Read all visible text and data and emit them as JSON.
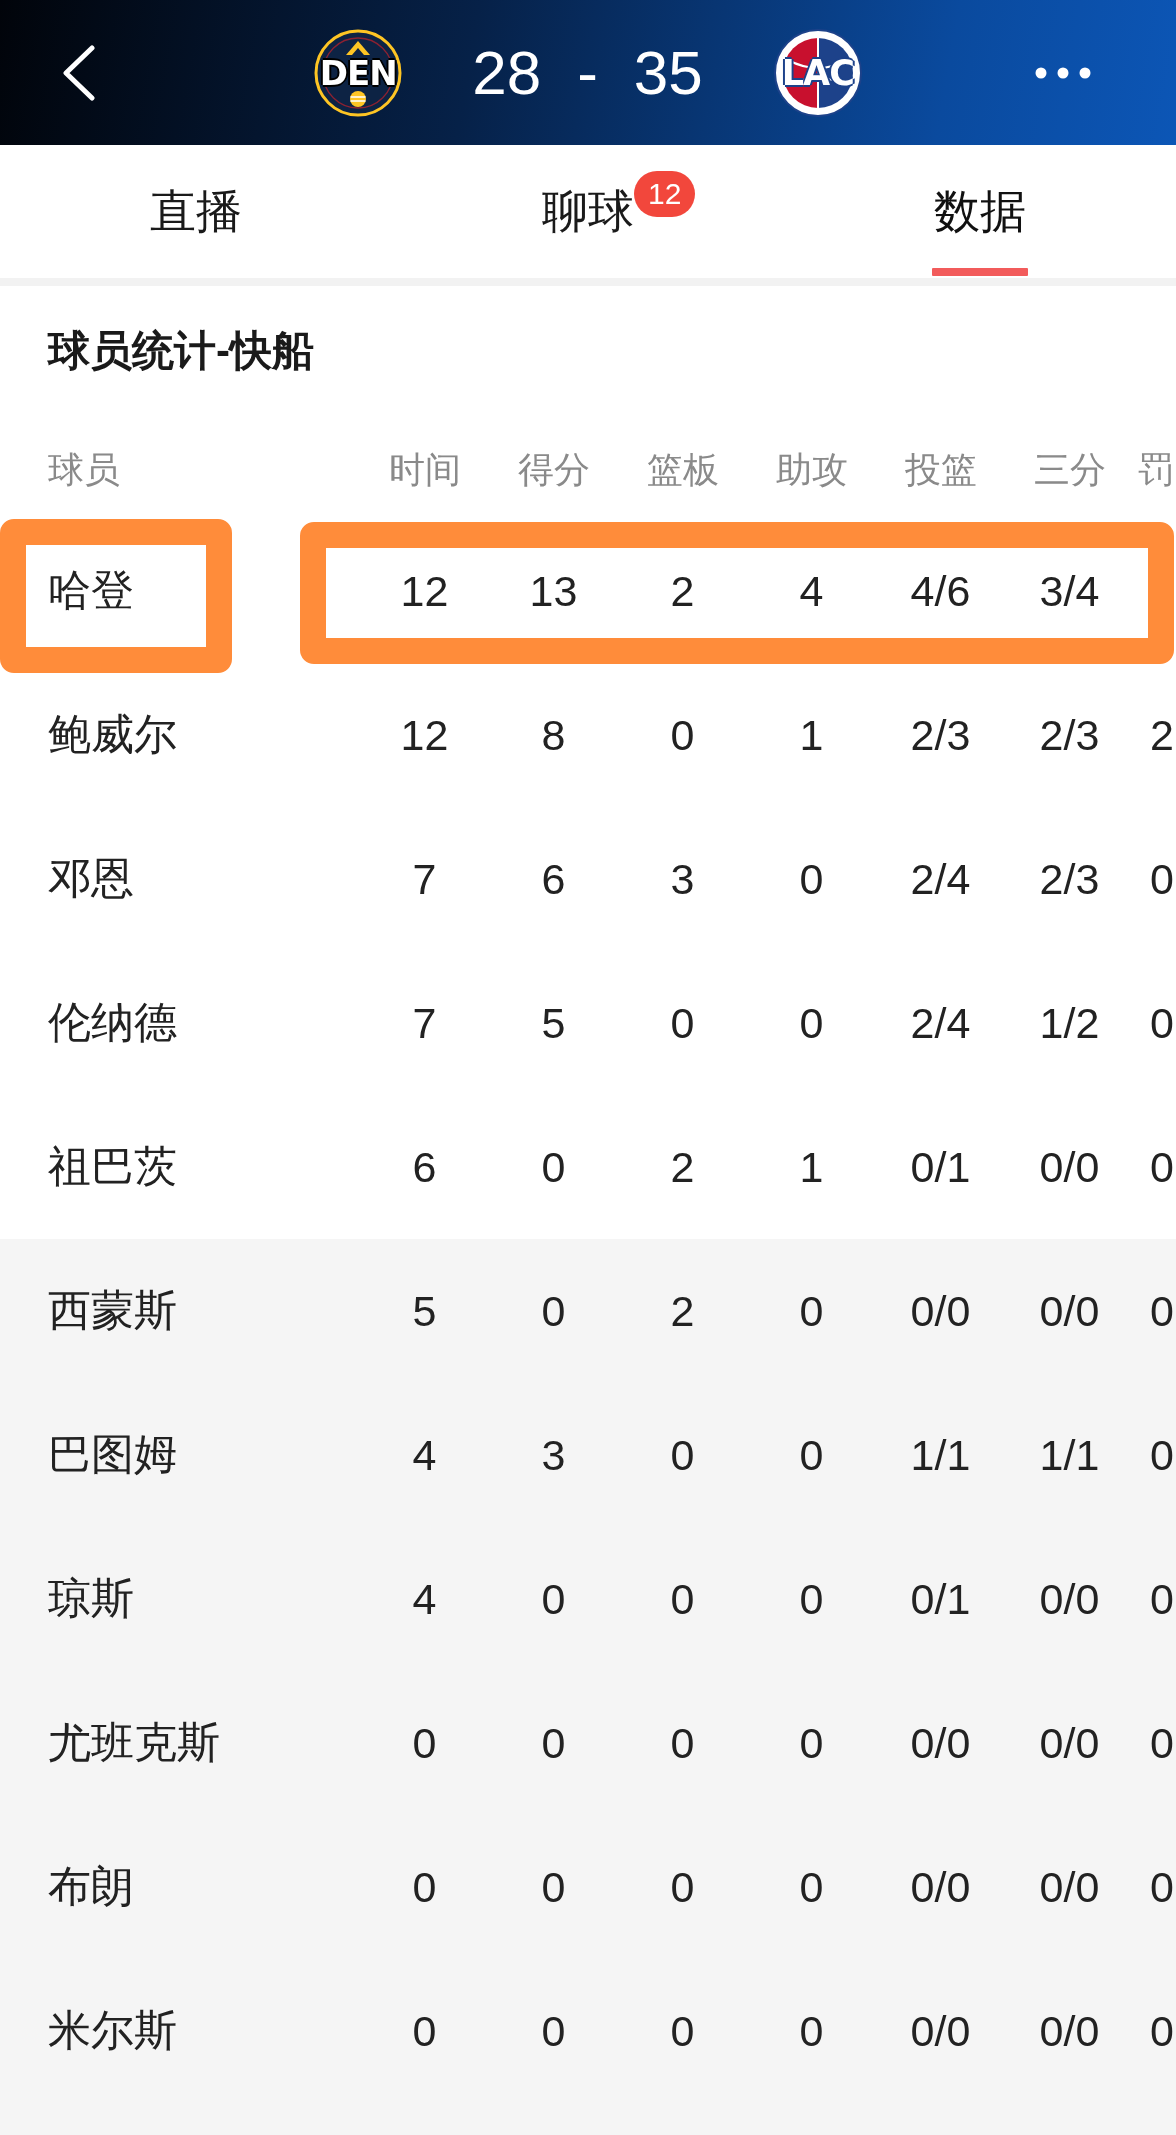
{
  "header": {
    "home": {
      "logo_text": "DEN",
      "score": "28"
    },
    "separator": "-",
    "away": {
      "logo_text": "LAC",
      "score": "35"
    }
  },
  "tabs": [
    {
      "label": "直播",
      "selected": false
    },
    {
      "label": "聊球",
      "selected": false,
      "badge": "12"
    },
    {
      "label": "数据",
      "selected": true
    }
  ],
  "section_title": "球员统计-快船",
  "table": {
    "columns": [
      "球员",
      "时间",
      "得分",
      "篮板",
      "助攻",
      "投篮",
      "三分",
      "罚"
    ],
    "rows": [
      {
        "cells": [
          "哈登",
          "12",
          "13",
          "2",
          "4",
          "4/6",
          "3/4"
        ],
        "starter": true,
        "highlighted": true
      },
      {
        "cells": [
          "鲍威尔",
          "12",
          "8",
          "0",
          "1",
          "2/3",
          "2/3",
          "2"
        ],
        "starter": true,
        "highlighted": false
      },
      {
        "cells": [
          "邓恩",
          "7",
          "6",
          "3",
          "0",
          "2/4",
          "2/3",
          "0"
        ],
        "starter": true,
        "highlighted": false
      },
      {
        "cells": [
          "伦纳德",
          "7",
          "5",
          "0",
          "0",
          "2/4",
          "1/2",
          "0"
        ],
        "starter": true,
        "highlighted": false
      },
      {
        "cells": [
          "祖巴茨",
          "6",
          "0",
          "2",
          "1",
          "0/1",
          "0/0",
          "0"
        ],
        "starter": true,
        "highlighted": false
      },
      {
        "cells": [
          "西蒙斯",
          "5",
          "0",
          "2",
          "0",
          "0/0",
          "0/0",
          "0"
        ],
        "starter": false,
        "highlighted": false
      },
      {
        "cells": [
          "巴图姆",
          "4",
          "3",
          "0",
          "0",
          "1/1",
          "1/1",
          "0"
        ],
        "starter": false,
        "highlighted": false
      },
      {
        "cells": [
          "琼斯",
          "4",
          "0",
          "0",
          "0",
          "0/1",
          "0/0",
          "0"
        ],
        "starter": false,
        "highlighted": false
      },
      {
        "cells": [
          "尤班克斯",
          "0",
          "0",
          "0",
          "0",
          "0/0",
          "0/0",
          "0"
        ],
        "starter": false,
        "highlighted": false
      },
      {
        "cells": [
          "布朗",
          "0",
          "0",
          "0",
          "0",
          "0/0",
          "0/0",
          "0"
        ],
        "starter": false,
        "highlighted": false
      },
      {
        "cells": [
          "米尔斯",
          "0",
          "0",
          "0",
          "0",
          "0/0",
          "0/0",
          "0"
        ],
        "starter": false,
        "highlighted": false
      }
    ]
  }
}
